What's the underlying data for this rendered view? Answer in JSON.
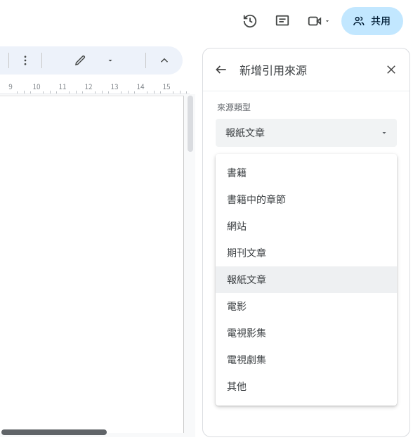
{
  "topbar": {
    "share_label": "共用"
  },
  "ruler": {
    "numbers": [
      9,
      10,
      11,
      12,
      13,
      14,
      15
    ]
  },
  "panel": {
    "title": "新增引用來源",
    "field_label": "來源類型",
    "selected": "報紙文章",
    "options": [
      "書籍",
      "書籍中的章節",
      "網站",
      "期刊文章",
      "報紙文章",
      "電影",
      "電視影集",
      "電視劇集",
      "其他"
    ]
  }
}
